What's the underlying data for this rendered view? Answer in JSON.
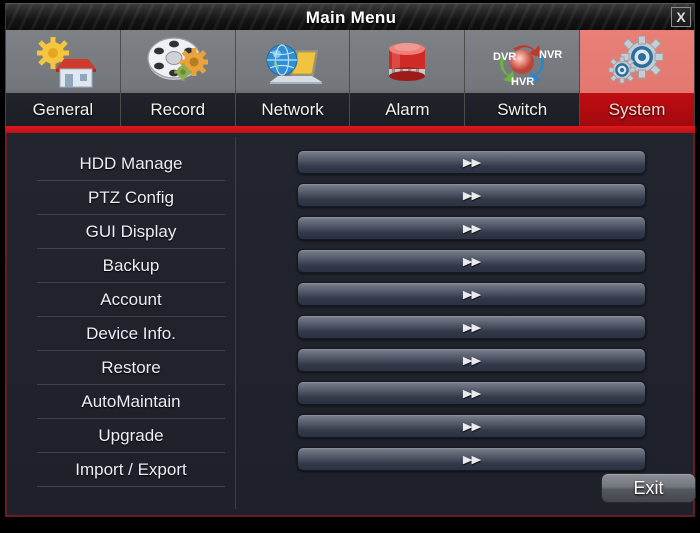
{
  "window": {
    "title": "Main Menu",
    "close_label": "X"
  },
  "tabs": [
    {
      "label": "General",
      "icon": "house-gear-icon",
      "active": false
    },
    {
      "label": "Record",
      "icon": "film-reel-gear-icon",
      "active": false
    },
    {
      "label": "Network",
      "icon": "globe-laptop-icon",
      "active": false
    },
    {
      "label": "Alarm",
      "icon": "siren-beacon-icon",
      "active": false
    },
    {
      "label": "Switch",
      "icon": "dvr-nvr-hvr-cycle-icon",
      "active": false
    },
    {
      "label": "System",
      "icon": "gears-icon",
      "active": true
    }
  ],
  "switch_icon_labels": {
    "top_left": "DVR",
    "top_right": "NVR",
    "bottom": "HVR"
  },
  "menu": {
    "items": [
      {
        "label": "HDD Manage",
        "button": "▶▶"
      },
      {
        "label": "PTZ Config",
        "button": "▶▶"
      },
      {
        "label": "GUI Display",
        "button": "▶▶"
      },
      {
        "label": "Backup",
        "button": "▶▶"
      },
      {
        "label": "Account",
        "button": "▶▶"
      },
      {
        "label": "Device Info.",
        "button": "▶▶"
      },
      {
        "label": "Restore",
        "button": "▶▶"
      },
      {
        "label": "AutoMaintain",
        "button": "▶▶"
      },
      {
        "label": "Upgrade",
        "button": "▶▶"
      },
      {
        "label": "Import / Export",
        "button": "▶▶"
      }
    ]
  },
  "footer": {
    "exit_label": "Exit"
  },
  "colors": {
    "accent_red": "#c00d12",
    "tab_active_top": "#e98077",
    "panel_bg": "#20222c",
    "panel_border": "#6b1d24",
    "title_bg": "#151515"
  }
}
